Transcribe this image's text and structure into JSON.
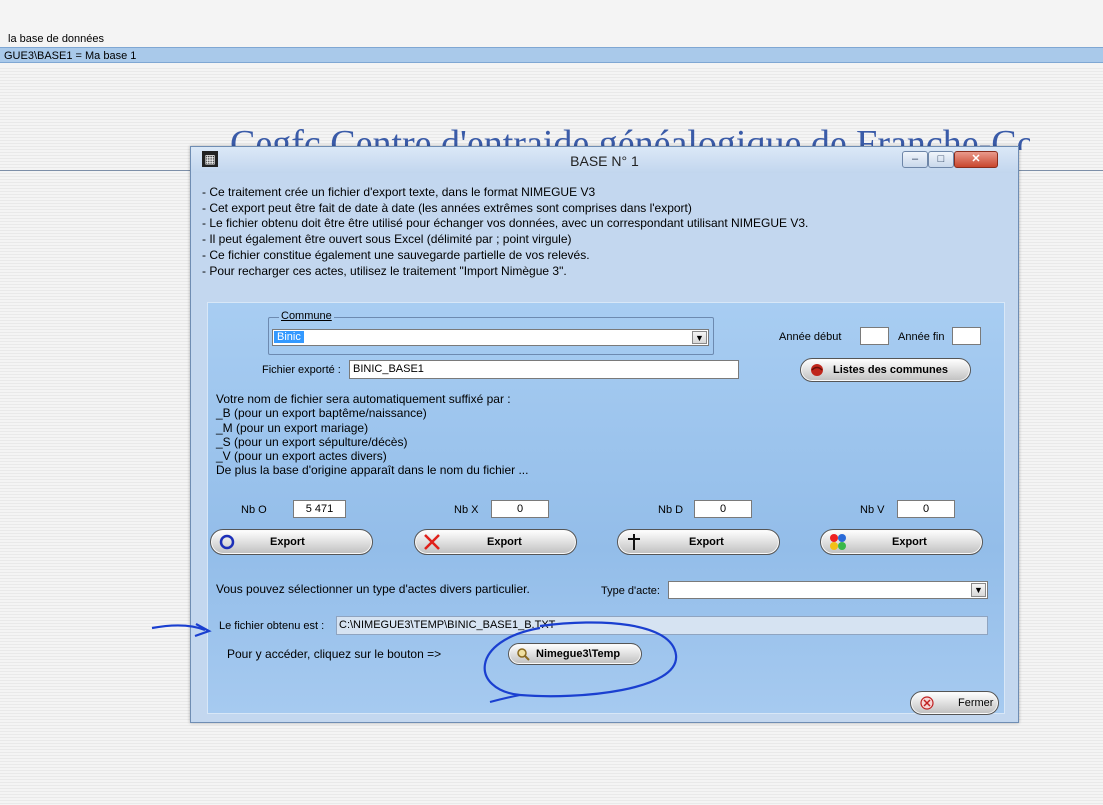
{
  "background": {
    "db_label": "la base de données",
    "db_row": "GUE3\\BASE1  =  Ma base  1",
    "banner": "Cegfc  Centre d'entraide généalogique de Franche-Comté"
  },
  "window": {
    "title": "BASE N° 1",
    "minimize": "–",
    "maximize": "□",
    "close": "✕"
  },
  "info_lines": [
    "- Ce traitement crée un fichier d'export texte, dans le format NIMEGUE V3",
    "- Cet export peut être fait de date à date (les années extrêmes sont comprises dans l'export)",
    "- Le fichier obtenu doit être être utilisé pour échanger vos données, avec un correspondant utilisant NIMEGUE V3.",
    "- Il peut également être ouvert sous Excel (délimité par  ;  point virgule)",
    "- Ce fichier constitue également une sauvegarde partielle de vos relevés.",
    "- Pour recharger ces actes, utilisez le traitement \"Import Nimègue 3\"."
  ],
  "commune": {
    "label": "Commune",
    "value": "Binic"
  },
  "annee_debut_label": "Année début",
  "annee_fin_label": "Année fin",
  "fichier_label": "Fichier exporté :",
  "fichier_value": "BINIC_BASE1",
  "listes_button": "Listes des communes",
  "suffix_lines": [
    "Votre nom de fichier sera automatiquement suffixé par :",
    "_B (pour un export baptême/naissance)",
    "_M (pour un export mariage)",
    "_S (pour un export sépulture/décès)",
    "_V (pour un export actes divers)",
    "De plus la base d'origine apparaît dans le nom du fichier ..."
  ],
  "counts": [
    {
      "label": "Nb O",
      "value": "5 471"
    },
    {
      "label": "Nb X",
      "value": "0"
    },
    {
      "label": "Nb D",
      "value": "0"
    },
    {
      "label": "Nb V",
      "value": "0"
    }
  ],
  "export_label": "Export",
  "select_type_text": "Vous pouvez sélectionner un type d'actes divers particulier.",
  "type_acte_label": "Type d'acte:",
  "type_acte_value": "",
  "result_label": "Le fichier obtenu est :",
  "result_path": "C:\\NIMEGUE3\\TEMP\\BINIC_BASE1_B.TXT",
  "access_text": "Pour y accéder, cliquez sur le bouton =>",
  "folder_button": "Nimegue3\\Temp",
  "close_button": "Fermer",
  "colors": {
    "panel": "#9fc6ee",
    "window": "#c3d7ef",
    "annotation": "#1a3fd0"
  }
}
